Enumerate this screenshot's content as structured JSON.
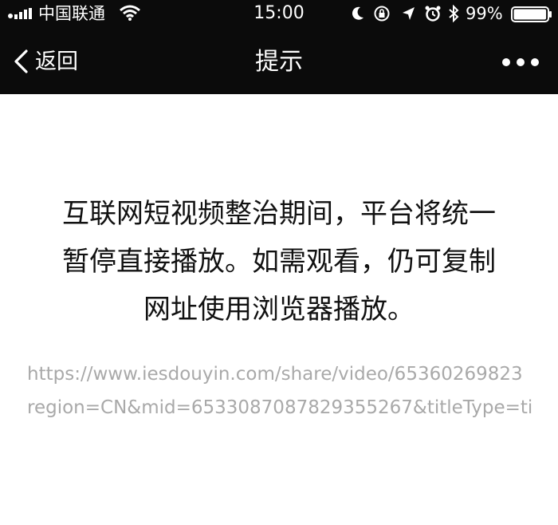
{
  "status_bar": {
    "carrier": "中国联通",
    "time": "15:00",
    "battery_percent": "99%",
    "battery_level": 0.99,
    "icons": [
      "signal-icon",
      "wifi-icon",
      "moon-icon",
      "rotation-lock-icon",
      "location-icon",
      "alarm-icon",
      "bluetooth-icon",
      "battery-icon"
    ]
  },
  "nav": {
    "back_label": "返回",
    "title": "提示",
    "more_icon": "more-icon"
  },
  "content": {
    "message_lines": [
      "互联网短视频整治期间，平台将统一",
      "暂停直接播放。如需观看，仍可复制",
      "网址使用浏览器播放。"
    ],
    "url_lines": [
      "https://www.iesdouyin.com/share/video/65360269823",
      "region=CN&mid=6533087087829355267&titleType=ti"
    ]
  },
  "colors": {
    "topbar_bg": "#0b0b0b",
    "page_bg": "#ffffff",
    "message_text": "#111111",
    "url_text": "#a9a9a9"
  }
}
